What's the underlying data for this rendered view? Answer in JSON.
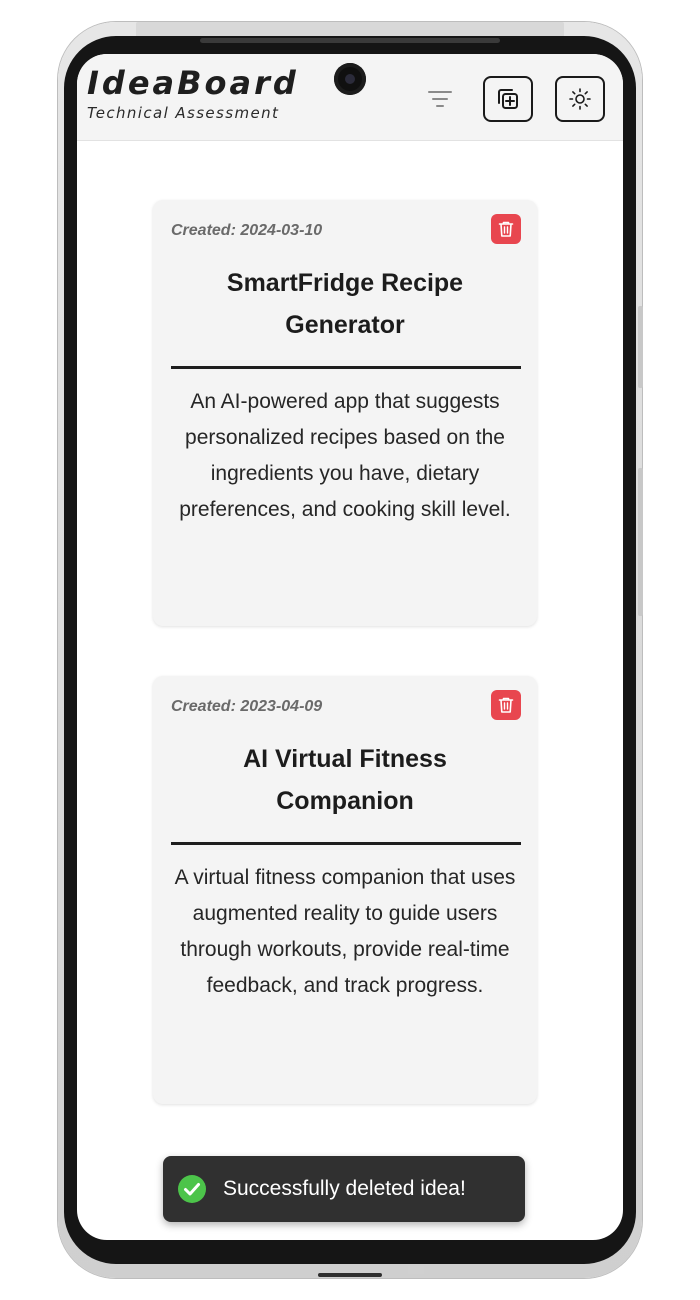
{
  "header": {
    "brand_title": "IdeaBoard",
    "brand_subtitle": "Technical Assessment",
    "icons": {
      "filter": "filter-icon",
      "add": "add-copy-icon",
      "theme": "sun-icon"
    }
  },
  "ideas": [
    {
      "created": "Created: 2024-03-10",
      "title": "SmartFridge Recipe Generator",
      "description": "An AI-powered app that suggests personalized recipes based on the ingredients you have, dietary preferences, and cooking skill level."
    },
    {
      "created": "Created: 2023-04-09",
      "title": "AI Virtual Fitness Companion",
      "description": "A virtual fitness companion that uses augmented reality to guide users through workouts, provide real-time feedback, and track progress."
    }
  ],
  "toast": {
    "message": "Successfully deleted idea!",
    "icon": "check-circle-icon"
  },
  "colors": {
    "delete_red": "#e8464f",
    "toast_bg": "#303030",
    "toast_success": "#4cc44a",
    "card_bg": "#f4f4f4",
    "header_bg": "#f4f4f4"
  }
}
